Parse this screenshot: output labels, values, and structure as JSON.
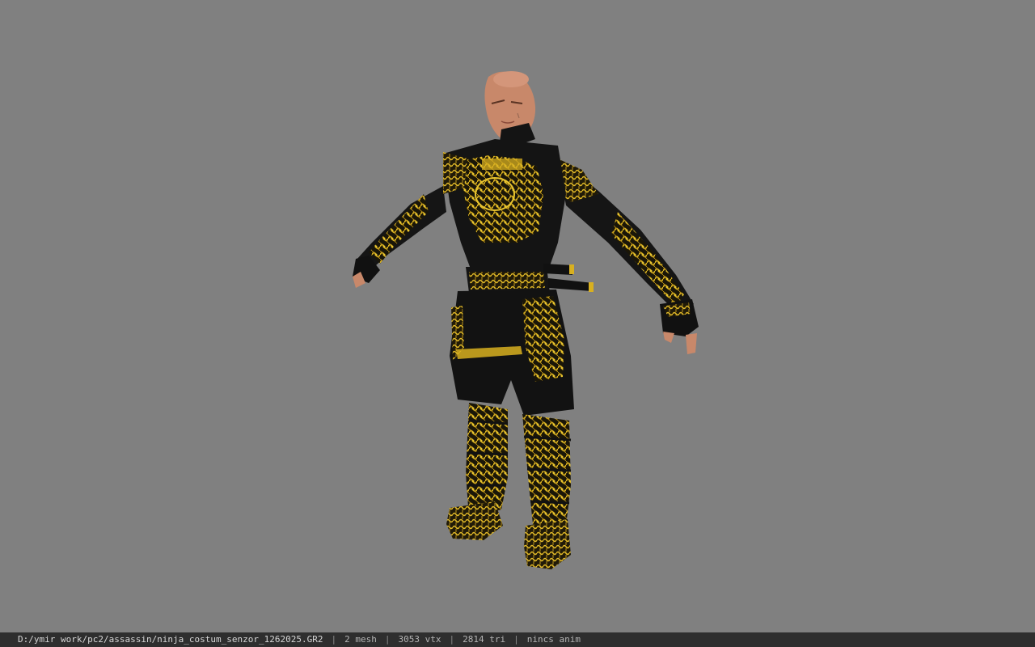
{
  "viewer": {
    "background_color": "#808080",
    "model_icon": "ninja-character-model"
  },
  "statusbar": {
    "file_path": "D:/ymir work/pc2/assassin/ninja_costum_senzor_1262025.GR2",
    "mesh_count": "2 mesh",
    "vertex_count": "3053 vtx",
    "triangle_count": "2814 tri",
    "animation": "nincs anim",
    "separator": "|"
  },
  "colors": {
    "skin": "#c8886a",
    "armor_black": "#141414",
    "armor_gold": "#d8b020"
  }
}
